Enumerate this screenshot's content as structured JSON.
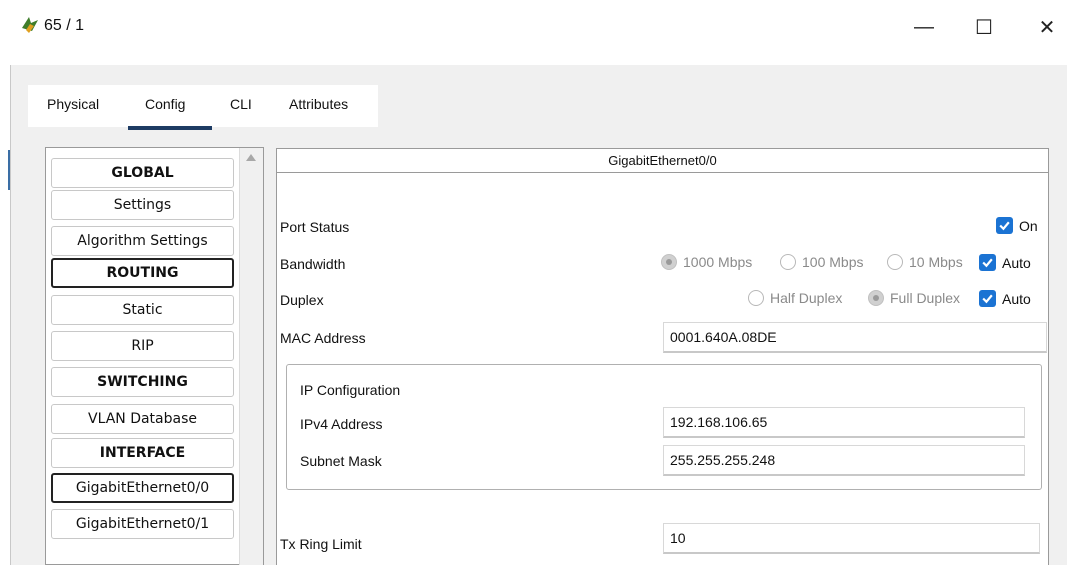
{
  "window": {
    "title": "65 / 1",
    "app_icon": "packet-tracer-router-icon",
    "minimize_glyph": "—",
    "maximize_glyph": "☐",
    "close_glyph": "✕"
  },
  "tabs": [
    {
      "label": "Physical"
    },
    {
      "label": "Config",
      "active": true
    },
    {
      "label": "CLI"
    },
    {
      "label": "Attributes"
    }
  ],
  "sidebar": {
    "items": [
      {
        "label": "GLOBAL",
        "type": "header"
      },
      {
        "label": "Settings",
        "type": "item"
      },
      {
        "label": "Algorithm Settings",
        "type": "item"
      },
      {
        "label": "ROUTING",
        "type": "header"
      },
      {
        "label": "Static",
        "type": "item"
      },
      {
        "label": "RIP",
        "type": "item"
      },
      {
        "label": "SWITCHING",
        "type": "header"
      },
      {
        "label": "VLAN Database",
        "type": "item"
      },
      {
        "label": "INTERFACE",
        "type": "header"
      },
      {
        "label": "GigabitEthernet0/0",
        "type": "item",
        "selected": true
      },
      {
        "label": "GigabitEthernet0/1",
        "type": "item"
      }
    ]
  },
  "interface": {
    "title": "GigabitEthernet0/0",
    "port_status": {
      "label": "Port Status",
      "checkbox_label": "On",
      "checked": true
    },
    "bandwidth": {
      "label": "Bandwidth",
      "options": [
        "1000 Mbps",
        "100 Mbps",
        "10 Mbps"
      ],
      "selected": "1000 Mbps",
      "auto_label": "Auto",
      "auto_checked": true
    },
    "duplex": {
      "label": "Duplex",
      "options": [
        "Half Duplex",
        "Full Duplex"
      ],
      "selected": "Full Duplex",
      "auto_label": "Auto",
      "auto_checked": true
    },
    "mac": {
      "label": "MAC Address",
      "value": "0001.640A.08DE"
    },
    "ip_config": {
      "group_label": "IP Configuration",
      "ipv4_label": "IPv4 Address",
      "ipv4_value": "192.168.106.65",
      "mask_label": "Subnet Mask",
      "mask_value": "255.255.255.248"
    },
    "tx_ring": {
      "label": "Tx Ring Limit",
      "value": "10"
    }
  },
  "colors": {
    "accent": "#1b73d3",
    "tab_underline": "#1d3b63",
    "panel_bg": "#f0f0f0"
  }
}
